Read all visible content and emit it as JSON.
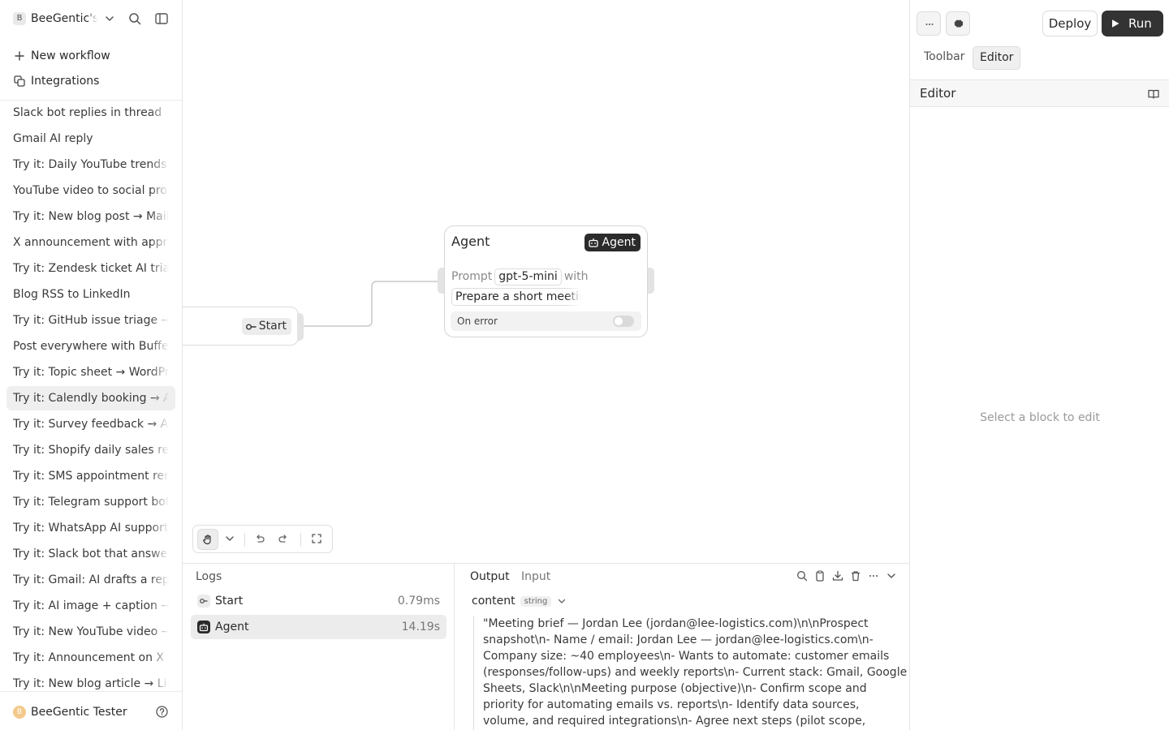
{
  "sidebar": {
    "workspace_initial": "B",
    "workspace_name": "BeeGentic's",
    "nav": [
      {
        "label": "New workflow",
        "icon": "plus-icon"
      },
      {
        "label": "Integrations",
        "icon": "integrations-icon"
      }
    ],
    "workflows": [
      "Slack bot replies in thread",
      "Gmail AI reply",
      "Try it: Daily YouTube trends digest",
      "YouTube video to social promo",
      "Try it: New blog post → Mailchimp",
      "X announcement with approval",
      "Try it: Zendesk ticket AI triage",
      "Blog RSS to LinkedIn",
      "Try it: GitHub issue triage → Slack",
      "Post everywhere with Buffer",
      "Try it: Topic sheet → WordPress",
      "Try it: Calendly booking → AI brief",
      "Try it: Survey feedback → AI summary",
      "Try it: Shopify daily sales report",
      "Try it: SMS appointment reminders",
      "Try it: Telegram support bot",
      "Try it: WhatsApp AI support agent",
      "Try it: Slack bot that answers questions",
      "Try it: Gmail: AI drafts a reply",
      "Try it: AI image + caption → Instagram",
      "Try it: New YouTube video → X post",
      "Try it: Announcement on X (Twitter)",
      "Try it: New blog article → LinkedIn"
    ],
    "active_workflow_index": 11,
    "user_initial": "B",
    "user_name": "BeeGentic Tester"
  },
  "canvas": {
    "start_node": {
      "label": "Start"
    },
    "agent_node": {
      "title": "Agent",
      "badge": "Agent",
      "prompt_label": "Prompt",
      "model": "gpt-5-mini",
      "with_label": "with",
      "prompt_preview": "Prepare a short meeting brief",
      "on_error_label": "On error",
      "on_error_enabled": false
    }
  },
  "logs": {
    "title": "Logs",
    "rows": [
      {
        "label": "Start",
        "duration": "0.79ms"
      },
      {
        "label": "Agent",
        "duration": "14.19s"
      }
    ],
    "active_index": 1
  },
  "output": {
    "tabs": [
      "Output",
      "Input"
    ],
    "active_tab": "Output",
    "field_key": "content",
    "field_type": "string",
    "content": "\"Meeting brief — Jordan Lee (jordan@lee-logistics.com)\\n\\nProspect snapshot\\n- Name / email: Jordan Lee — jordan@lee-logistics.com\\n- Company size: ~40 employees\\n- Wants to automate: customer emails (responses/follow-ups) and weekly reports\\n- Current stack: Gmail, Google Sheets, Slack\\n\\nMeeting purpose (objective)\\n- Confirm scope and priority for automating emails vs. reports\\n- Identify data sources, volume, and required integrations\\n- Agree next steps (pilot scope, timeline,"
  },
  "right_panel": {
    "deploy_label": "Deploy",
    "run_label": "Run",
    "tabs": [
      "Toolbar",
      "Editor"
    ],
    "active_tab": "Editor",
    "section_title": "Editor",
    "empty_hint": "Select a block to edit"
  }
}
